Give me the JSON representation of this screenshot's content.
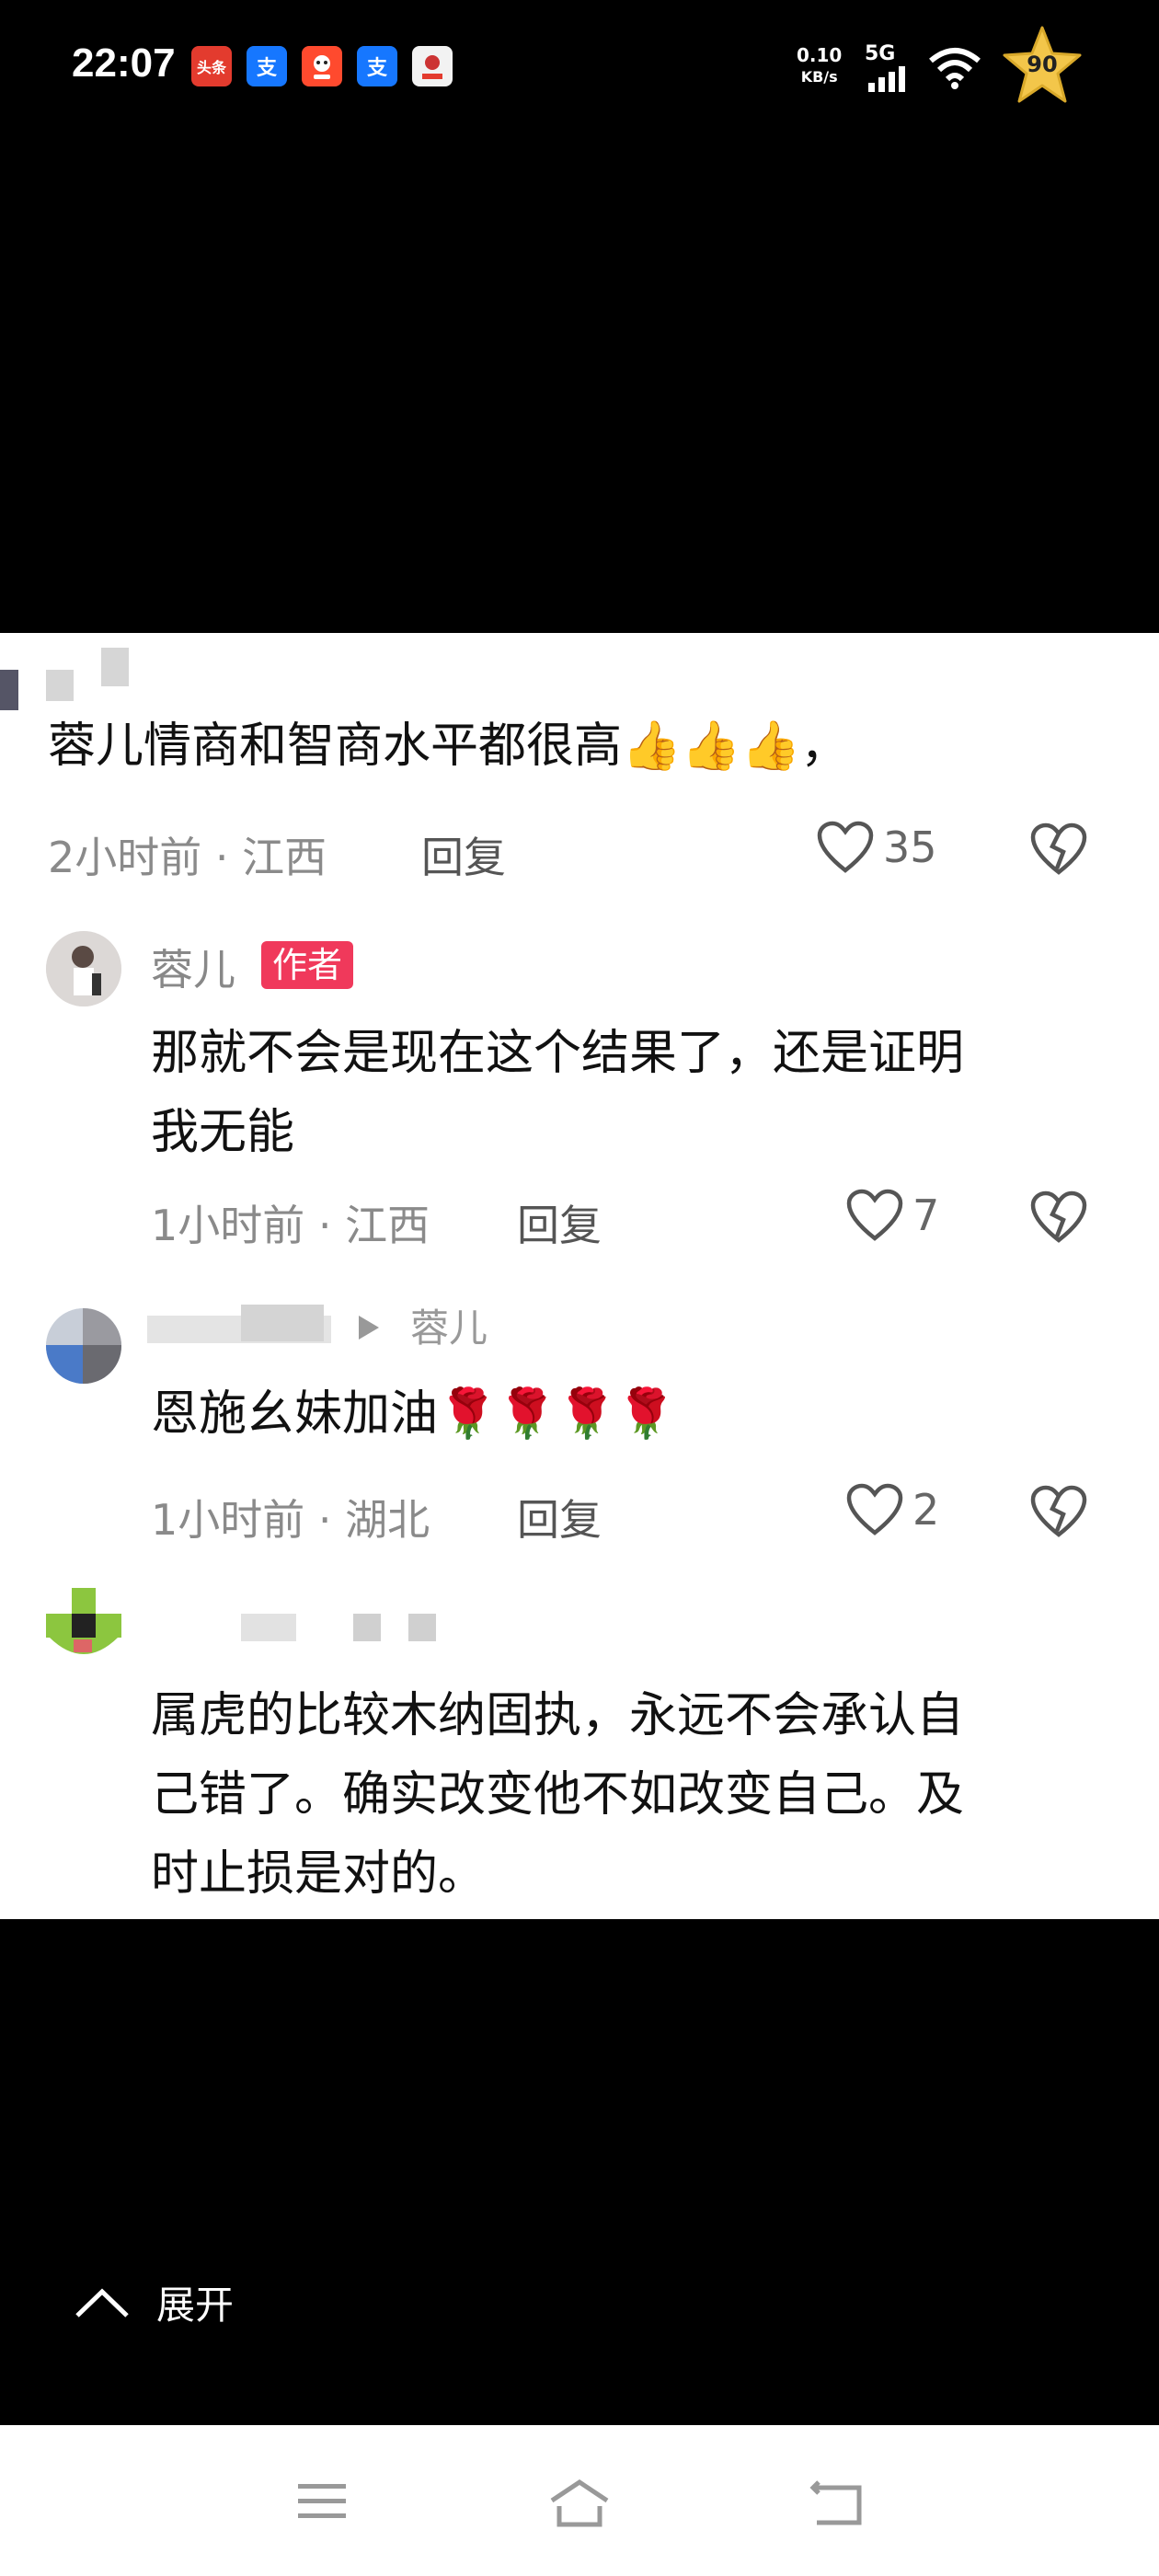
{
  "status_bar": {
    "time": "22:07",
    "apps": [
      {
        "name": "toutiao",
        "label": "头条",
        "color": "#e33b2e"
      },
      {
        "name": "alipay",
        "label": "支",
        "color": "#1677ff"
      },
      {
        "name": "taobao",
        "label": "",
        "color": "#ff4a2e"
      },
      {
        "name": "alipay",
        "label": "支",
        "color": "#1677ff"
      },
      {
        "name": "news-app",
        "label": "",
        "color": "#f2f2f2"
      }
    ],
    "net_speed_value": "0.10",
    "net_speed_unit": "KB/s",
    "network": "5G",
    "battery_level": "90"
  },
  "comments": [
    {
      "text": "蓉儿情商和智商水平都很高👍👍👍，",
      "time_location": "2小时前 · 江西",
      "reply_label": "回复",
      "likes": "35"
    },
    {
      "username": "蓉儿",
      "badge": "作者",
      "text_lines": [
        "那就不会是现在这个结果了，还是证明",
        "我无能"
      ],
      "time_location": "1小时前 · 江西",
      "reply_label": "回复",
      "likes": "7"
    },
    {
      "reply_to": "蓉儿",
      "text": "恩施幺妹加油🌹🌹🌹🌹",
      "time_location": "1小时前 · 湖北",
      "reply_label": "回复",
      "likes": "2"
    },
    {
      "text_lines": [
        "属虎的比较木纳固执，永远不会承认自",
        "己错了。确实改变他不如改变自己。及",
        "时止损是对的。"
      ]
    }
  ],
  "expand_label": "展开",
  "nav": {
    "items": [
      "menu-icon",
      "home-icon",
      "back-icon"
    ]
  }
}
